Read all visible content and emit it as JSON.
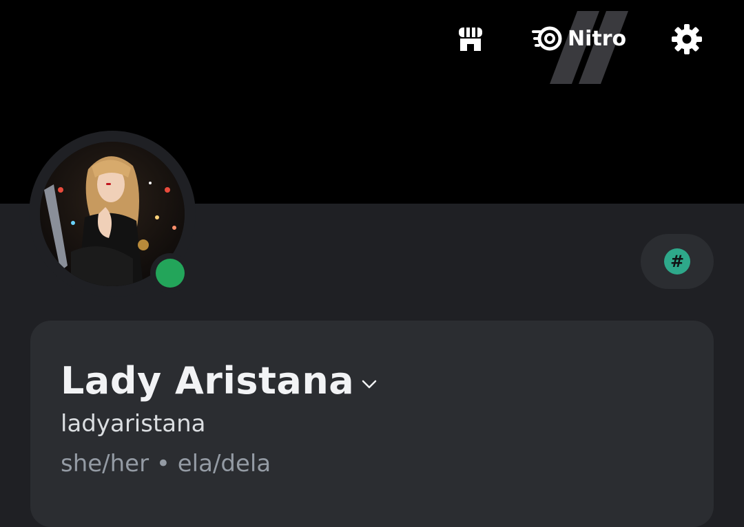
{
  "header": {
    "shop_icon": "shop-icon",
    "nitro_icon": "nitro-icon",
    "nitro_label": "Nitro",
    "settings_icon": "gear-icon"
  },
  "profile": {
    "avatar_alt": "profile-photo",
    "status": "online",
    "status_color": "#23a55a",
    "tag_symbol": "#",
    "tag_color": "#2ea88a",
    "display_name": "Lady Aristana",
    "username": "ladyaristana",
    "pronouns": "she/her • ela/dela"
  },
  "colors": {
    "banner": "#000000",
    "background": "#1f2024",
    "card": "#2b2d31"
  }
}
